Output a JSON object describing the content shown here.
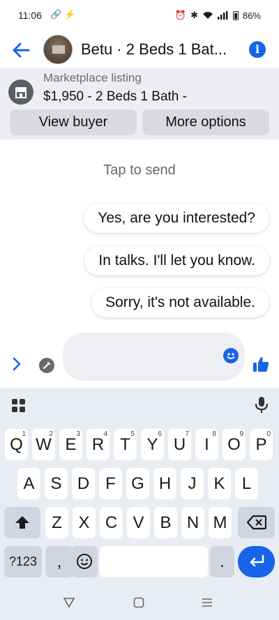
{
  "status_bar": {
    "time": "11:06",
    "battery": "86%"
  },
  "header": {
    "title": "Betu · 2 Beds 1 Bat..."
  },
  "listing": {
    "label": "Marketplace listing",
    "title": "$1,950 - 2 Beds 1 Bath -",
    "view_buyer": "View buyer",
    "more_options": "More options"
  },
  "chat": {
    "hint": "Tap to send",
    "quick_replies": [
      "Yes, are you interested?",
      "In talks. I'll let you know.",
      "Sorry, it's not available."
    ]
  },
  "composer": {
    "placeholder": ""
  },
  "keyboard": {
    "row1": [
      {
        "k": "Q",
        "n": "1"
      },
      {
        "k": "W",
        "n": "2"
      },
      {
        "k": "E",
        "n": "3"
      },
      {
        "k": "R",
        "n": "4"
      },
      {
        "k": "T",
        "n": "5"
      },
      {
        "k": "Y",
        "n": "6"
      },
      {
        "k": "U",
        "n": "7"
      },
      {
        "k": "I",
        "n": "8"
      },
      {
        "k": "O",
        "n": "9"
      },
      {
        "k": "P",
        "n": "0"
      }
    ],
    "row2": [
      "A",
      "S",
      "D",
      "F",
      "G",
      "H",
      "J",
      "K",
      "L"
    ],
    "row3": [
      "Z",
      "X",
      "C",
      "V",
      "B",
      "N",
      "M"
    ],
    "symbols": "?123",
    "comma": ",",
    "period": "."
  },
  "colors": {
    "accent": "#1664e8",
    "banner_bg": "#eceef1",
    "keyboard_bg": "#e8edf4"
  }
}
